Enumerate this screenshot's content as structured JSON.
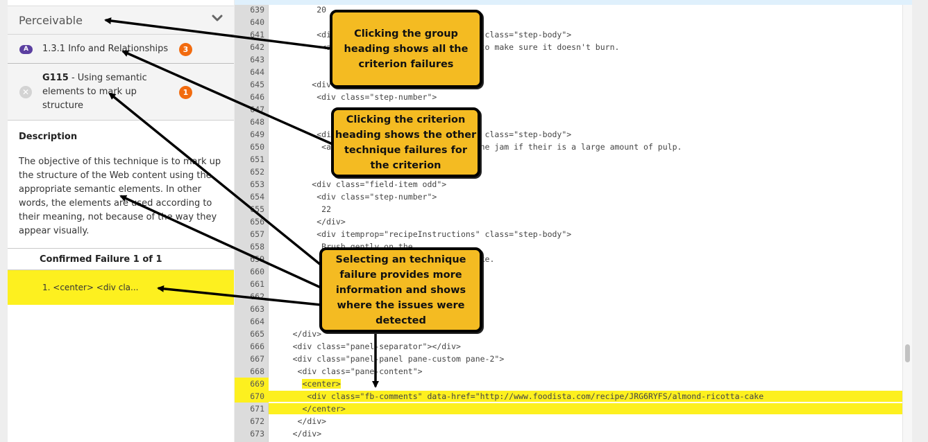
{
  "sidebar": {
    "group": {
      "title": "Perceivable",
      "icon": "chevron-down-icon"
    },
    "criterion": {
      "level": "A",
      "label": "1.3.1 Info and Relationships",
      "count": "3"
    },
    "technique": {
      "status_icon": "close-circle-icon",
      "id": "G115",
      "separator": " - ",
      "label": "Using semantic elements to mark up structure",
      "count": "1"
    },
    "description": {
      "heading": "Description",
      "text": "The objective of this technique is to mark up the structure of the Web content using the appropriate semantic elements. In other words, the elements are used according to their meaning, not because of the way they appear visually."
    },
    "failures": {
      "header": "Confirmed Failure 1 of 1",
      "items": [
        {
          "label": "1. <center> <div cla..."
        }
      ]
    }
  },
  "code": {
    "lines": [
      {
        "n": "639",
        "text": "          20",
        "hl": ""
      },
      {
        "n": "640",
        "text": "",
        "hl": ""
      },
      {
        "n": "641",
        "text": "          <div itemprop=\"recipeInstructions\" class=\"step-body\">",
        "hl": ""
      },
      {
        "n": "642",
        "text": "           <a href=\"/glossary/PZ4\">Stir </a>to make sure it doesn't burn.",
        "hl": ""
      },
      {
        "n": "643",
        "text": "",
        "hl": ""
      },
      {
        "n": "644",
        "text": "",
        "hl": ""
      },
      {
        "n": "645",
        "text": "         <div class=\"field-item even\">",
        "hl": ""
      },
      {
        "n": "646",
        "text": "          <div class=\"step-number\">",
        "hl": ""
      },
      {
        "n": "647",
        "text": "",
        "hl": ""
      },
      {
        "n": "648",
        "text": "",
        "hl": ""
      },
      {
        "n": "649",
        "text": "          <div itemprop=\"recipeInstructions\" class=\"step-body\">",
        "hl": ""
      },
      {
        "n": "650",
        "text": "           <a href=\"/glossary/\">Strain </a>the jam if their is a large amount of pulp.",
        "hl": ""
      },
      {
        "n": "651",
        "text": "",
        "hl": ""
      },
      {
        "n": "652",
        "text": "",
        "hl": ""
      },
      {
        "n": "653",
        "text": "         <div class=\"field-item odd\">",
        "hl": ""
      },
      {
        "n": "654",
        "text": "          <div class=\"step-number\">",
        "hl": ""
      },
      {
        "n": "655",
        "text": "           22",
        "hl": ""
      },
      {
        "n": "656",
        "text": "          </div>",
        "hl": ""
      },
      {
        "n": "657",
        "text": "          <div itemprop=\"recipeInstructions\" class=\"step-body\">",
        "hl": ""
      },
      {
        "n": "658",
        "text": "           Brush gently on the",
        "hl": ""
      },
      {
        "n": "659",
        "text": "           <a href=\"/glossary/\">baked </a>cake.",
        "hl": ""
      },
      {
        "n": "660",
        "text": "",
        "hl": ""
      },
      {
        "n": "661",
        "text": "",
        "hl": ""
      },
      {
        "n": "662",
        "text": "",
        "hl": ""
      },
      {
        "n": "663",
        "text": "",
        "hl": ""
      },
      {
        "n": "664",
        "text": "",
        "hl": ""
      },
      {
        "n": "665",
        "text": "     </div>",
        "hl": ""
      },
      {
        "n": "666",
        "text": "     <div class=\"panel-separator\"></div>",
        "hl": ""
      },
      {
        "n": "667",
        "text": "     <div class=\"panel-panel pane-custom pane-2\">",
        "hl": ""
      },
      {
        "n": "668",
        "text": "      <div class=\"pane-content\">",
        "hl": ""
      },
      {
        "n": "669",
        "text": "       <center>",
        "hl": "num-code"
      },
      {
        "n": "670",
        "text": "        <div class=\"fb-comments\" data-href=\"http://www.foodista.com/recipe/JRG6RYFS/almond-ricotta-cake",
        "hl": "full"
      },
      {
        "n": "671",
        "text": "       </center>",
        "hl": "full-code"
      },
      {
        "n": "672",
        "text": "      </div>",
        "hl": ""
      },
      {
        "n": "673",
        "text": "     </div>",
        "hl": ""
      }
    ]
  },
  "callouts": [
    {
      "id": "group",
      "text": "Clicking the group heading shows all the criterion failures"
    },
    {
      "id": "criterion",
      "text": "Clicking the criterion heading shows the other technique failures for the criterion"
    },
    {
      "id": "technique",
      "text": "Selecting an technique failure  provides more information and shows where the issues were detected"
    }
  ],
  "colors": {
    "highlight": "#fdf01f",
    "callout": "#f4bb22",
    "level_badge": "#5b3fa0",
    "count_badge": "#f26b0f"
  }
}
